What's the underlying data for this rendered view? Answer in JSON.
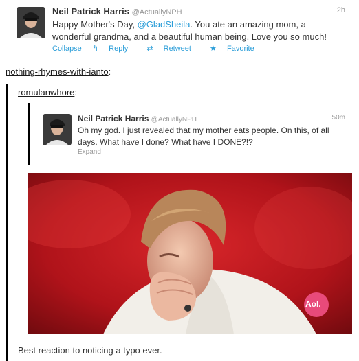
{
  "tweet1": {
    "name": "Neil Patrick Harris",
    "handle": "@ActuallyNPH",
    "time": "2h",
    "text_before": "Happy Mother's Day, ",
    "mention": "@GladSheila",
    "text_after": ". You ate an amazing mom, a wonderful grandma, and a beautiful human being. Love you so much!",
    "actions": [
      "Collapse",
      "Reply",
      "Retweet",
      "Favorite"
    ],
    "action_icons": [
      "none",
      "reply-arrow-icon",
      "retweet-icon",
      "star-icon"
    ]
  },
  "reblog": {
    "user": "nothing-rhymes-with-ianto",
    "user_suffix": ":"
  },
  "quote": {
    "user": "romulanwhore",
    "user_suffix": ":"
  },
  "tweet2": {
    "name": "Neil Patrick Harris",
    "handle": "@ActuallyNPH",
    "time": "50m",
    "text": "Oh my god. I just revealed that my mother eats people. On this, of all days. What have I done? What have I DONE?!?",
    "action": "Expand"
  },
  "gif": {
    "watermark": "Aol."
  },
  "caption": "Best reaction to noticing a typo ever.",
  "colors": {
    "mention": "#2a9dd8",
    "bar": "#000000",
    "gif_bg": "#c0141b"
  }
}
